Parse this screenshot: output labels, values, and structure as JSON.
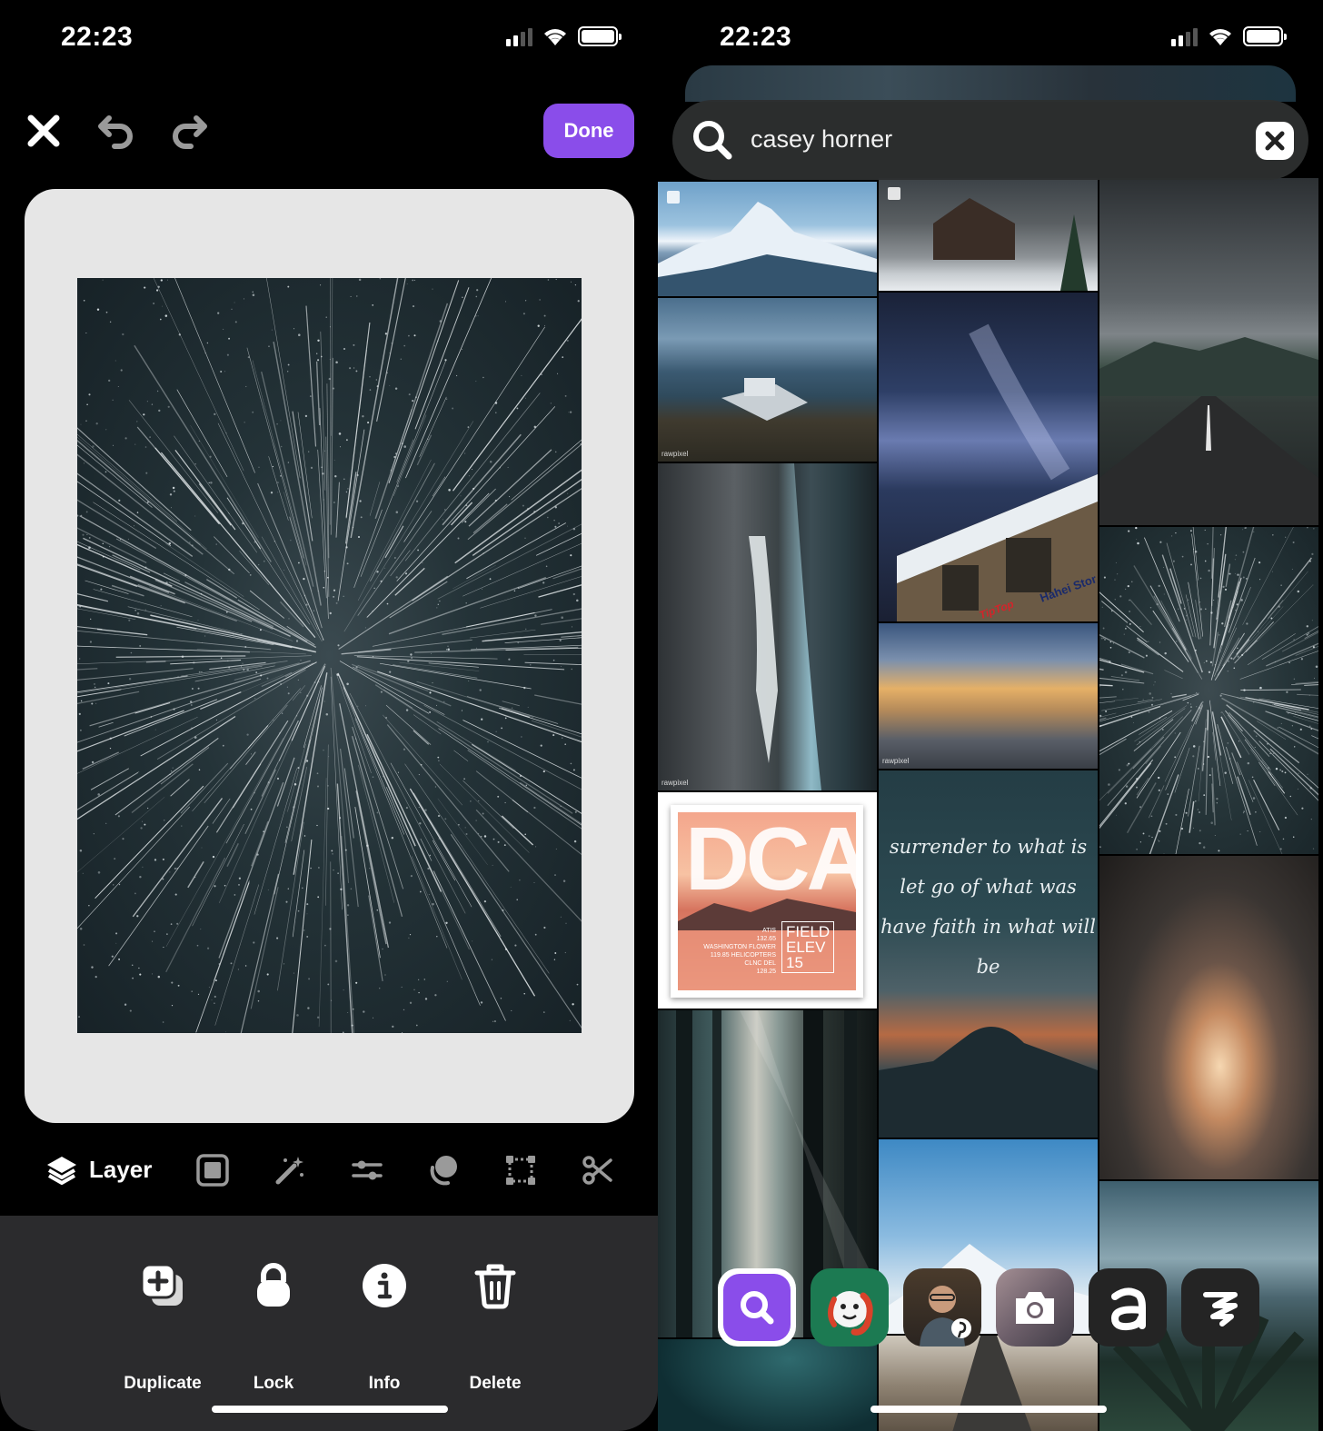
{
  "left": {
    "status": {
      "time": "22:23"
    },
    "toolbar": {
      "done_label": "Done"
    },
    "tools": {
      "layer_label": "Layer"
    },
    "actions": [
      {
        "label": "Duplicate"
      },
      {
        "label": "Lock"
      },
      {
        "label": "Info"
      },
      {
        "label": "Delete"
      }
    ]
  },
  "right": {
    "status": {
      "time": "22:23"
    },
    "search": {
      "query": "casey horner"
    },
    "tiles": {
      "watermark": "rawpixel",
      "sign_text": "Hahei Stor",
      "brand_text": "TipTop",
      "quote_lines": [
        "surrender to what is",
        "let go of what was",
        "have faith in what will be"
      ],
      "dca_big": "DCA",
      "dca_small_lines": [
        "FIELD",
        "ELEV",
        "15"
      ],
      "dca_detail_lines": [
        "ATIS",
        "132.65",
        "WASHINGTON FLOWER",
        "119.85 HELICOPTERS",
        "CLNC DEL",
        "128.25"
      ]
    }
  },
  "colors": {
    "accent": "#8a4dea",
    "sheet": "#2b2b2d",
    "canvas_bg": "#e6e6e6"
  }
}
